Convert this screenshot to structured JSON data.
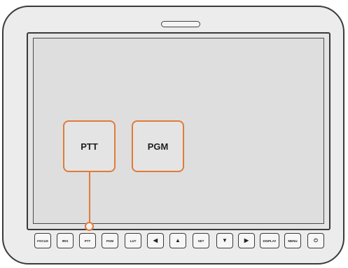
{
  "screen": {
    "zoom_labels": {
      "ptt": "PTT",
      "pgm": "PGM"
    }
  },
  "buttons": {
    "focus": "FOCUS",
    "iris": "IRIS",
    "ptt": "PTT",
    "pgm": "PGM",
    "lut": "LUT",
    "left": "◀",
    "up": "▲",
    "set": "SET",
    "down": "▼",
    "right": "▶",
    "display": "DISPLAY",
    "menu": "MENU",
    "power": "⏻"
  },
  "colors": {
    "callout": "#e07b39",
    "outline": "#3a3a3a"
  },
  "icons": {
    "left": "left-arrow-icon",
    "up": "up-arrow-icon",
    "down": "down-arrow-icon",
    "right": "right-arrow-icon",
    "power": "power-icon"
  }
}
